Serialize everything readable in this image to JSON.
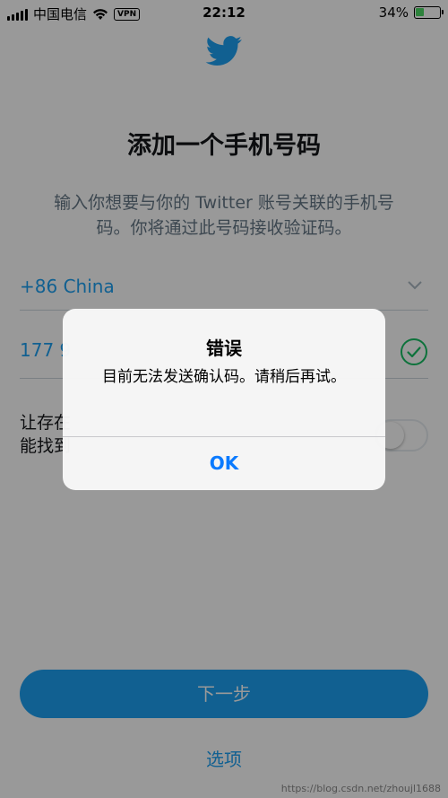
{
  "status_bar": {
    "carrier": "中国电信",
    "vpn": "VPN",
    "time": "22:12",
    "battery_text": "34%",
    "battery_level": 0.34
  },
  "header": {
    "icon": "twitter-bird-icon",
    "title": "添加一个手机号码",
    "description": "输入你想要与你的 Twitter 账号关联的手机号码。你将通过此号码接收验证码。"
  },
  "form": {
    "country": "+86 China",
    "phone_value": "177 9",
    "discover_text": "让存在\n能找到",
    "discover_toggle_on": false
  },
  "footer": {
    "next_label": "下一步",
    "options_label": "选项"
  },
  "watermark": "https://blog.csdn.net/zhoujl1688",
  "alert": {
    "title": "错误",
    "message": "目前无法发送确认码。请稍后再试。",
    "ok_label": "OK"
  },
  "colors": {
    "brand": "#1da1f2",
    "check": "#17bf63",
    "ios_blue": "#0a7aff"
  }
}
